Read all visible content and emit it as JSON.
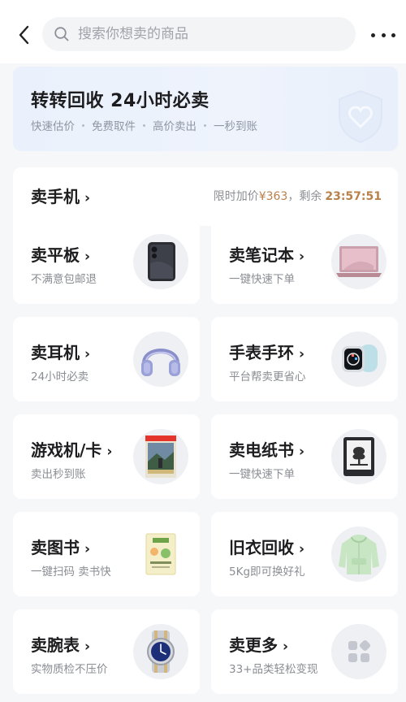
{
  "header": {
    "search_placeholder": "搜索你想卖的商品"
  },
  "banner": {
    "title": "转转回收 24小时必卖",
    "features": [
      "快速估价",
      "免费取件",
      "高价卖出",
      "一秒到账"
    ]
  },
  "phone": {
    "label": "卖手机",
    "promo_prefix": "限时加价",
    "promo_price": "¥363",
    "promo_sep": "，剩余",
    "timer": "23:57:51"
  },
  "categories": [
    {
      "title": "卖平板",
      "subtitle": "不满意包邮退",
      "icon": "tablet-icon"
    },
    {
      "title": "卖笔记本",
      "subtitle": "一键快速下单",
      "icon": "laptop-icon"
    },
    {
      "title": "卖耳机",
      "subtitle": "24小时必卖",
      "icon": "headphones-icon"
    },
    {
      "title": "手表手环",
      "subtitle": "平台帮卖更省心",
      "icon": "smartwatch-icon"
    },
    {
      "title": "游戏机/卡",
      "subtitle": "卖出秒到账",
      "icon": "game-card-icon"
    },
    {
      "title": "卖电纸书",
      "subtitle": "一键快速下单",
      "icon": "ereader-icon"
    },
    {
      "title": "卖图书",
      "subtitle": "一键扫码 卖书快",
      "icon": "book-icon"
    },
    {
      "title": "旧衣回收",
      "subtitle": "5Kg即可换好礼",
      "icon": "hoodie-icon"
    },
    {
      "title": "卖腕表",
      "subtitle": "实物质检不压价",
      "icon": "wristwatch-icon"
    },
    {
      "title": "卖更多",
      "subtitle": "33+品类轻松变现",
      "icon": "more-grid-icon"
    }
  ]
}
